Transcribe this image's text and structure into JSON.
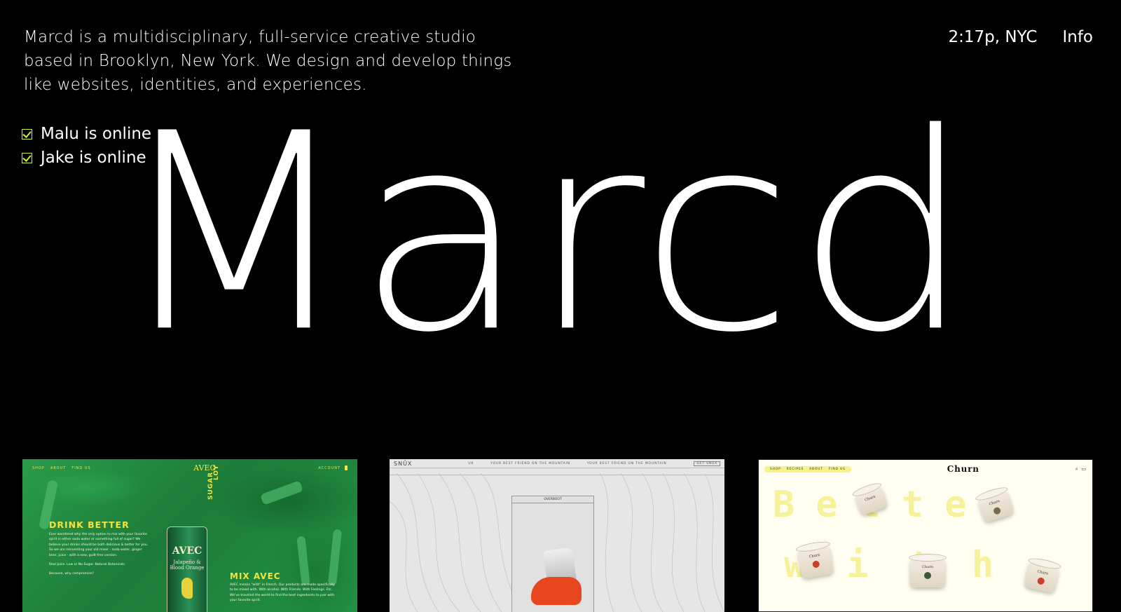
{
  "intro": {
    "line1": "Marcd is a multidisciplinary, full-service creative studio",
    "line2": "based in Brooklyn, New York. We design and develop things",
    "line3": "like websites, identities, and experiences."
  },
  "status": [
    {
      "label": "Malu is online"
    },
    {
      "label": "Jake is online"
    }
  ],
  "header": {
    "time": "2:17p, NYC",
    "info_link": "Info"
  },
  "wordmark": "Marcd",
  "colors": {
    "background": "#000000",
    "text": "#ffffff",
    "check_accent": "#c9f22e"
  },
  "projects": [
    {
      "name": "AVEC",
      "nav": {
        "shop": "SHOP",
        "about": "ABOUT",
        "find_us": "FIND US",
        "account": "ACCOUNT"
      },
      "heading": "DRINK BETTER",
      "body": "Ever wondered why the only option to mix with your favorite spirit is either soda water or something full of sugar? We believe your drinks should be both delicious & better for you. So we are reinventing your old mixer - soda water, ginger beer, juice - with a new, guilt-free version.",
      "tagline": "Real Juice. Low or No Sugar. Natural Botanicals.",
      "question": "Because, why compromise?",
      "mix_heading": "MIX AVEC",
      "mix_body": "AVEC means \"with\" in French. Our products are made specifically to be mixed with. With alcohol. With Friends. With Feelings. Etc. We've traveled the world to find the best ingredients to pair with your favorite spirit.",
      "side_words": [
        "SUGAR",
        "LOY"
      ],
      "can_brand": "AVEC",
      "can_flavor": "Jalapeño & Blood Orange"
    },
    {
      "name": "SNŪX",
      "logo": "SNŪX",
      "nav_items": [
        "UK",
        "YOUR BEST FRIEND ON THE MOUNTAIN",
        "YOUR BEST FRIEND ON THE MOUNTAIN"
      ],
      "button": "GET SNUX",
      "panel_title": "OVERBOOT"
    },
    {
      "name": "Churn",
      "logo": "Churn",
      "nav": {
        "shop": "SHOP",
        "recipes": "RECIPES",
        "about": "ABOUT",
        "find_us": "FIND US"
      },
      "big_word_1": "Better",
      "big_word_2": "with",
      "jar_label": "Churn"
    }
  ]
}
